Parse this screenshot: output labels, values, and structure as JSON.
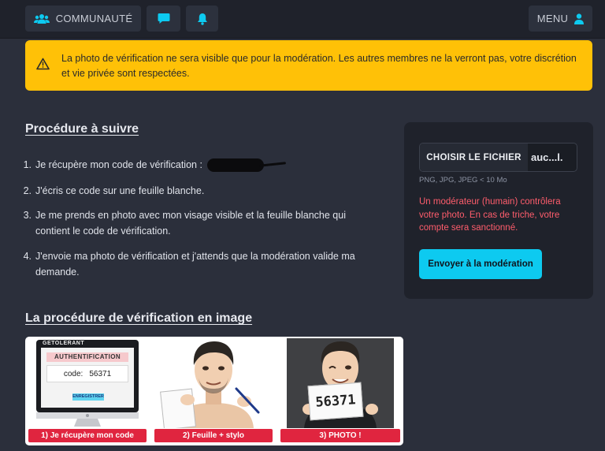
{
  "topbar": {
    "community_label": "COMMUNAUTÉ",
    "menu_label": "MENU"
  },
  "alert": {
    "message": "La photo de vérification ne sera visible que pour la modération. Les autres membres ne la verront pas, votre discrétion et vie privée sont respectées."
  },
  "procedure": {
    "title": "Procédure à suivre",
    "steps": [
      {
        "num": "1.",
        "text": "Je récupère mon code de vérification :"
      },
      {
        "num": "2.",
        "text": "J'écris ce code sur une feuille blanche."
      },
      {
        "num": "3.",
        "text": "Je me prends en photo avec mon visage visible et la feuille blanche qui contient le code de vérification."
      },
      {
        "num": "4.",
        "text": "J'envoie ma photo de vérification et j'attends que la modération valide ma demande."
      }
    ]
  },
  "upload": {
    "choose_label": "CHOISIR LE FICHIER",
    "file_name": "auc...l.",
    "hint": "PNG, JPG, JPEG < 10 Mo",
    "warning": "Un modérateur (humain) contrôlera votre photo. En cas de triche, votre compte sera sanctionné.",
    "submit_label": "Envoyer à la modération"
  },
  "image_section": {
    "title": "La procédure de vérification en image",
    "brand": "GETOLERANT",
    "auth_title": "AUTHENTIFICATION",
    "code_label": "code:",
    "code_value": "56371",
    "save_label": "ENREGISTRER",
    "paper_code": "56371",
    "captions": [
      "1) Je récupère mon code",
      "2) Feuille + stylo",
      "3) PHOTO !"
    ]
  },
  "colors": {
    "background": "#2b2f3b",
    "topbar": "#1f222b",
    "alert": "#ffc107",
    "accent": "#0dcaf0",
    "danger": "#ff5d6c",
    "caption": "#e0253f"
  },
  "icons": [
    "users-icon",
    "chat-icon",
    "bell-icon",
    "user-icon",
    "warning-triangle-icon"
  ]
}
